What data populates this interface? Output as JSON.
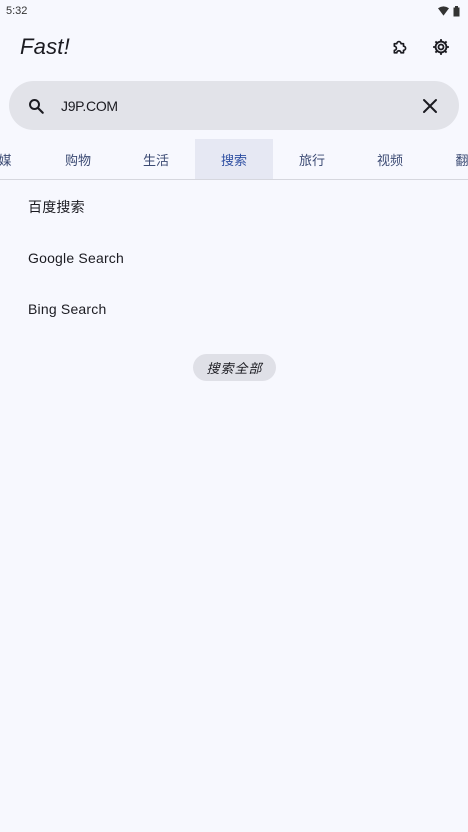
{
  "status_bar": {
    "time": "5:32"
  },
  "app_bar": {
    "title": "Fast!"
  },
  "search": {
    "value": "J9P.COM",
    "placeholder": ""
  },
  "tabs": [
    "媒",
    "购物",
    "生活",
    "搜索",
    "旅行",
    "视频",
    "翻"
  ],
  "active_tab_index": 3,
  "engines": [
    "百度搜索",
    "Google Search",
    "Bing Search"
  ],
  "search_all_label": "搜索全部",
  "colors": {
    "background": "#f7f8fe",
    "accent": "#3e5aa8",
    "search_bg": "#e2e3e9"
  }
}
